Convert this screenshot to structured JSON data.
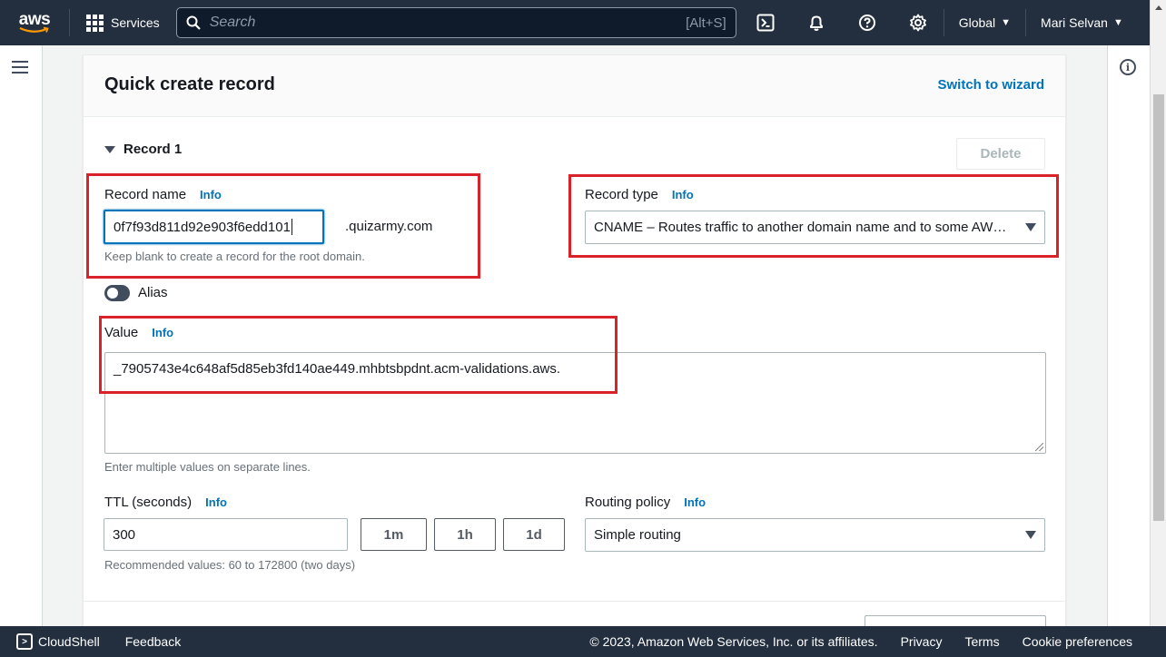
{
  "topnav": {
    "logo_text": "aws",
    "services_label": "Services",
    "search_placeholder": "Search",
    "search_shortcut": "[Alt+S]",
    "region_label": "Global",
    "user_label": "Mari Selvan",
    "icons": [
      "cloudshell-icon",
      "bell-icon",
      "help-icon",
      "gear-icon"
    ]
  },
  "card": {
    "title": "Quick create record",
    "switch_link": "Switch to wizard",
    "record_heading": "Record 1",
    "delete_label": "Delete"
  },
  "record_name": {
    "label": "Record name",
    "info": "Info",
    "value": "0f7f93d811d92e903f6edd101",
    "suffix": ".quizarmy.com",
    "hint": "Keep blank to create a record for the root domain."
  },
  "record_type": {
    "label": "Record type",
    "info": "Info",
    "value": "CNAME – Routes traffic to another domain name and to some AWS resources"
  },
  "alias": {
    "label": "Alias",
    "enabled": false
  },
  "value_field": {
    "label": "Value",
    "info": "Info",
    "value": "_7905743e4c648af5d85eb3fd140ae449.mhbtsbpdnt.acm-validations.aws.",
    "hint": "Enter multiple values on separate lines."
  },
  "ttl": {
    "label": "TTL (seconds)",
    "info": "Info",
    "value": "300",
    "buttons": [
      "1m",
      "1h",
      "1d"
    ],
    "hint": "Recommended values: 60 to 172800 (two days)"
  },
  "routing": {
    "label": "Routing policy",
    "info": "Info",
    "value": "Simple routing"
  },
  "footer": {
    "cloudshell": "CloudShell",
    "feedback": "Feedback",
    "copyright": "© 2023, Amazon Web Services, Inc. or its affiliates.",
    "privacy": "Privacy",
    "terms": "Terms",
    "cookies": "Cookie preferences"
  },
  "colors": {
    "nav_bg": "#232f3e",
    "link": "#0073bb",
    "highlight": "#d9222a"
  }
}
